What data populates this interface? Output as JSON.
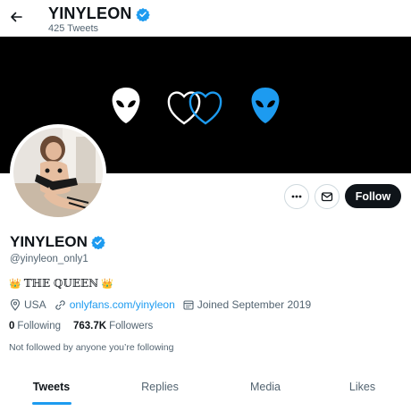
{
  "header": {
    "name": "YINYLEON",
    "tweet_count": "425 Tweets",
    "back_icon": "arrow-left-icon",
    "verified_icon": "verified-badge-icon"
  },
  "banner": {
    "background": "#000000",
    "icons": [
      "alien-head-icon-white",
      "two-hearts-icon",
      "alien-head-icon-blue"
    ],
    "accent": "#1d9bf0"
  },
  "actions": {
    "more_icon": "more-dots-icon",
    "message_icon": "envelope-icon",
    "follow_label": "Follow"
  },
  "profile": {
    "name": "YINYLEON",
    "handle": "@yinyleon_only1",
    "bio_text": "𝕋ℍ𝔼 ℚ𝕌𝔼𝔼ℕ",
    "bio_crown": "👑",
    "location": "USA",
    "website": "onlyfans.com/yinyleon",
    "joined": "Joined September 2019",
    "following_count": "0",
    "following_label": "Following",
    "followers_count": "763.7K",
    "followers_label": "Followers",
    "not_followed": "Not followed by anyone you’re following"
  },
  "tabs": [
    {
      "label": "Tweets",
      "active": true
    },
    {
      "label": "Replies",
      "active": false
    },
    {
      "label": "Media",
      "active": false
    },
    {
      "label": "Likes",
      "active": false
    }
  ],
  "colors": {
    "text": "#0f1419",
    "secondary": "#536471",
    "link": "#1d9bf0",
    "verified": "#1d9bf0",
    "follow_button": "#0f1419"
  }
}
